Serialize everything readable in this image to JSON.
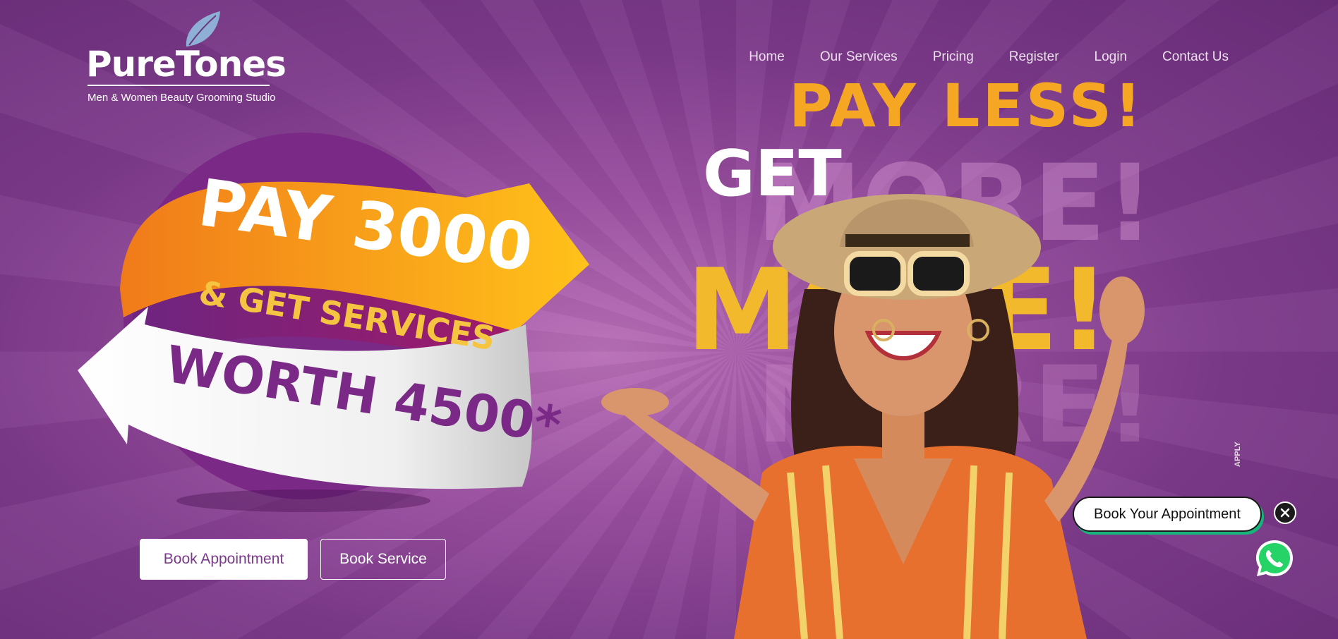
{
  "brand": {
    "name": "PureTones",
    "tagline": "Men & Women Beauty Grooming Studio",
    "leaf_color": "#8ab4d8"
  },
  "nav": {
    "items": [
      "Home",
      "Our Services",
      "Pricing",
      "Register",
      "Login",
      "Contact Us"
    ]
  },
  "promo": {
    "line1": "PAY 3000",
    "line2": "& GET SERVICES",
    "line3": "WORTH 4500*",
    "orange": "#f7a21b",
    "purple": "#7a2a86",
    "yellow": "#f5c542"
  },
  "headline": {
    "pay_less": "PAY LESS!",
    "get": "GET",
    "more": "MORE!",
    "more_ghost": "MORE!",
    "tnc": "APPLY"
  },
  "cta": {
    "book_appointment": "Book Appointment",
    "book_service": "Book Service"
  },
  "widget": {
    "book_your_appointment": "Book Your Appointment",
    "close_icon": "close-icon",
    "whatsapp_icon": "whatsapp-icon",
    "accent": "#18b37a"
  }
}
